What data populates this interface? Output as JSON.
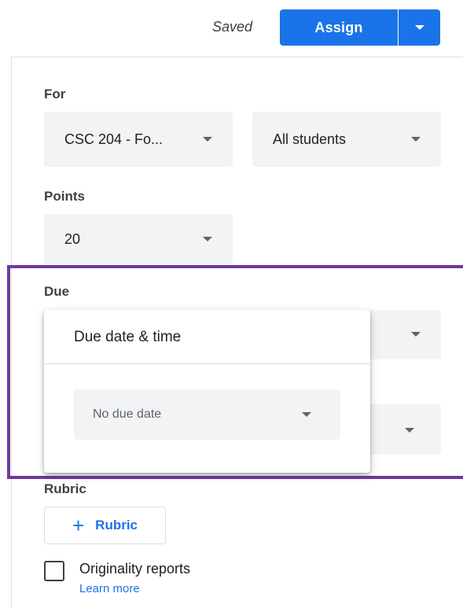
{
  "header": {
    "status": "Saved",
    "assign_label": "Assign"
  },
  "for_section": {
    "label": "For",
    "class_select": "CSC 204 - Fo...",
    "students_select": "All students"
  },
  "points_section": {
    "label": "Points",
    "value": "20"
  },
  "due_section": {
    "label": "Due",
    "popover_title": "Due date & time",
    "due_select": "No due date"
  },
  "rubric_section": {
    "label": "Rubric",
    "button_label": "Rubric"
  },
  "originality": {
    "label": "Originality reports",
    "link": "Learn more",
    "checked": false
  },
  "colors": {
    "accent": "#1a73e8",
    "highlight": "#6f3a9f"
  }
}
